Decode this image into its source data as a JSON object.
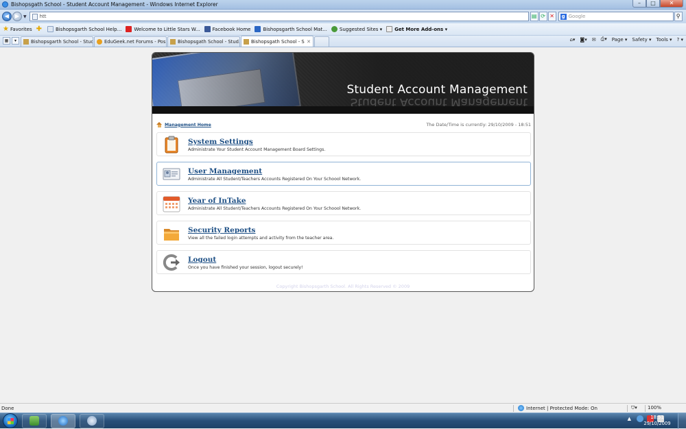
{
  "window": {
    "title": "Bishopsgath School - Student Account Management - Windows Internet Explorer",
    "minimize": "–",
    "maximize": "□",
    "close": "✕"
  },
  "address_bar": {
    "url": "htt",
    "search_placeholder": "Google"
  },
  "favorites_bar": {
    "favorites_label": "Favorites",
    "items": [
      {
        "label": "Bishopsgarth School Help...",
        "icon": "page-icon"
      },
      {
        "label": "Welcome to Little Stars W...",
        "icon": "star-red-icon"
      },
      {
        "label": "Facebook  Home",
        "icon": "facebook-icon"
      },
      {
        "label": "Bishopsgarth School Mat...",
        "icon": "e-icon"
      },
      {
        "label": "Suggested Sites ▾",
        "icon": "suggested-icon"
      },
      {
        "label": "Get More Add-ons ▾",
        "icon": "addons-icon"
      }
    ]
  },
  "tabs": [
    {
      "label": "Bishopsgarth School - Stud...",
      "active": false
    },
    {
      "label": "EduGeek.net Forums - Pos...",
      "active": false
    },
    {
      "label": "Bishopsgath School - Stud...",
      "active": false
    },
    {
      "label": "Bishopsgath School - S...",
      "active": true
    }
  ],
  "command_bar": {
    "page": "Page ▾",
    "safety": "Safety ▾",
    "tools": "Tools ▾",
    "help": "? ▾"
  },
  "page": {
    "header_title": "Student Account Management",
    "management_home": "Management Home",
    "datetime": "The Date/Time is currently: 29/10/2009 - 18:51",
    "menu": [
      {
        "title": "System Settings",
        "desc": "Administrate Your Student Account Management Board Settings.",
        "icon": "clipboard-icon"
      },
      {
        "title": "User Management",
        "desc": "Administrate All Student/Teachers Accounts Registered On Your Schoool Network.",
        "icon": "user-card-icon"
      },
      {
        "title": "Year of InTake",
        "desc": "Administrate All Student/Teachers Accounts Registered On Your Schoool Network.",
        "icon": "calendar-icon"
      },
      {
        "title": "Security Reports",
        "desc": "View all the failed login attempts and activity from the teacher area.",
        "icon": "folder-icon"
      },
      {
        "title": "Logout",
        "desc": "Once you have finished your session, logout securely!",
        "icon": "logout-icon"
      }
    ],
    "copyright": "Copyright Bishopsgarth School. All Rights Reserved © 2009"
  },
  "status_bar": {
    "status": "Done",
    "zone": "Internet | Protected Mode: On",
    "zoom": "100%"
  },
  "taskbar": {
    "time": "18:51",
    "date": "29/10/2009"
  }
}
